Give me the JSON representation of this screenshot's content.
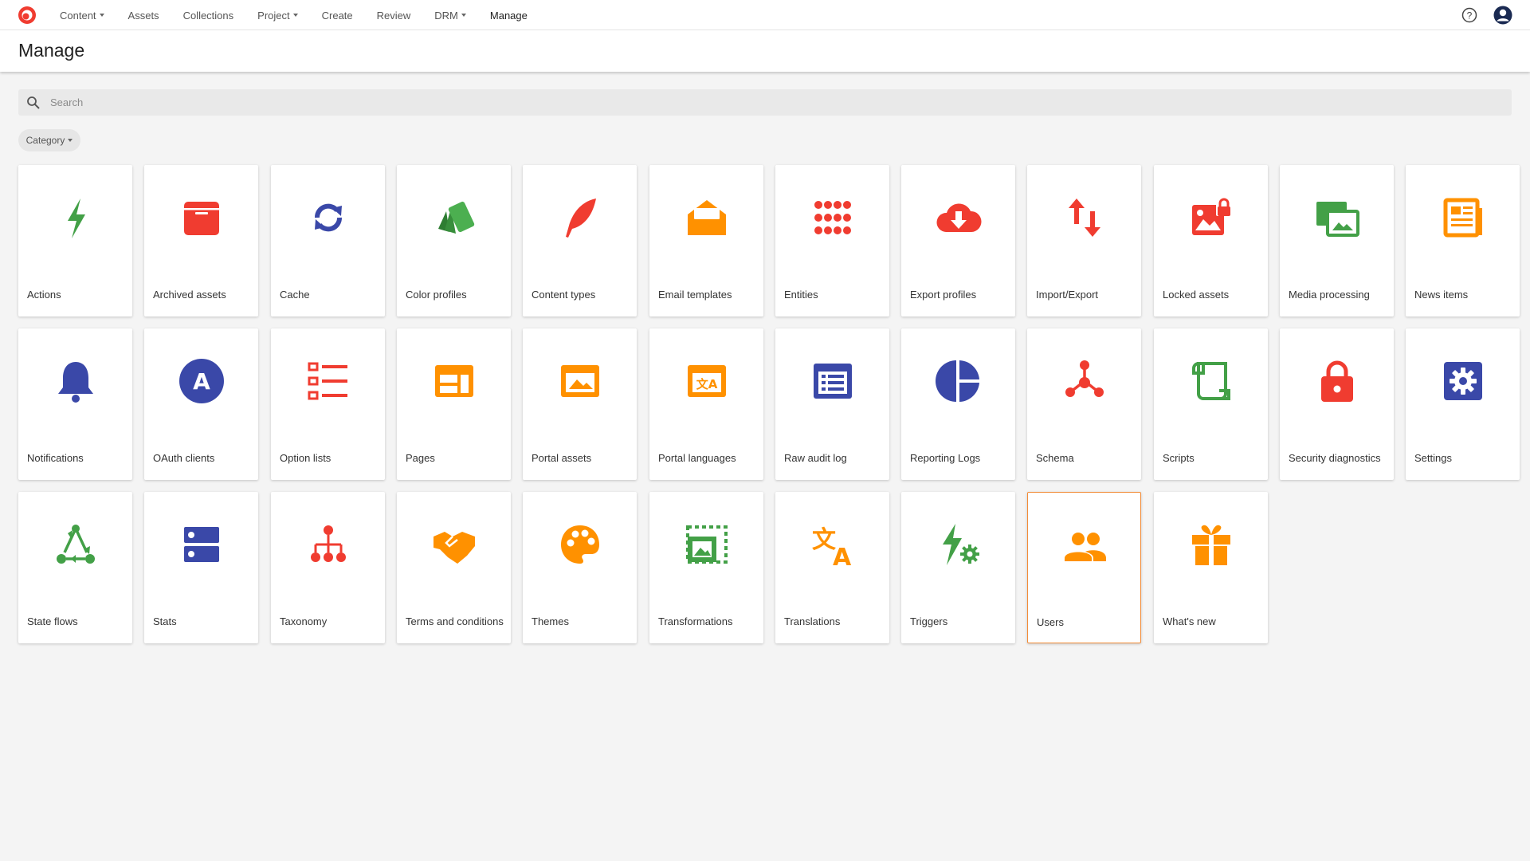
{
  "nav": {
    "items": [
      {
        "label": "Content",
        "dropdown": true
      },
      {
        "label": "Assets",
        "dropdown": false
      },
      {
        "label": "Collections",
        "dropdown": false
      },
      {
        "label": "Project",
        "dropdown": true
      },
      {
        "label": "Create",
        "dropdown": false
      },
      {
        "label": "Review",
        "dropdown": false
      },
      {
        "label": "DRM",
        "dropdown": true
      },
      {
        "label": "Manage",
        "dropdown": false,
        "active": true
      }
    ]
  },
  "header": {
    "title": "Manage"
  },
  "search": {
    "placeholder": "Search",
    "value": ""
  },
  "filter": {
    "category_label": "Category"
  },
  "colors": {
    "green": "#43a047",
    "red": "#f03c30",
    "blue": "#3a48a8",
    "orange": "#ff9100",
    "selected_border": "#f28c38"
  },
  "tiles": [
    {
      "label": "Actions",
      "icon": "bolt-icon"
    },
    {
      "label": "Archived assets",
      "icon": "archive-box-icon"
    },
    {
      "label": "Cache",
      "icon": "refresh-icon"
    },
    {
      "label": "Color profiles",
      "icon": "color-swatches-icon"
    },
    {
      "label": "Content types",
      "icon": "quill-feather-icon"
    },
    {
      "label": "Email templates",
      "icon": "open-envelope-icon"
    },
    {
      "label": "Entities",
      "icon": "dot-grid-icon"
    },
    {
      "label": "Export profiles",
      "icon": "cloud-download-icon"
    },
    {
      "label": "Import/Export",
      "icon": "up-down-arrows-icon"
    },
    {
      "label": "Locked assets",
      "icon": "locked-image-icon"
    },
    {
      "label": "Media processing",
      "icon": "media-images-icon"
    },
    {
      "label": "News items",
      "icon": "newspaper-icon"
    },
    {
      "label": "Notifications",
      "icon": "bell-icon"
    },
    {
      "label": "OAuth clients",
      "icon": "oauth-a-circle-icon"
    },
    {
      "label": "Option lists",
      "icon": "checklist-icon"
    },
    {
      "label": "Pages",
      "icon": "page-layout-icon"
    },
    {
      "label": "Portal assets",
      "icon": "portal-image-icon"
    },
    {
      "label": "Portal languages",
      "icon": "language-translate-box-icon"
    },
    {
      "label": "Raw audit log",
      "icon": "list-box-icon"
    },
    {
      "label": "Reporting Logs",
      "icon": "pie-chart-icon"
    },
    {
      "label": "Schema",
      "icon": "hub-network-icon"
    },
    {
      "label": "Scripts",
      "icon": "scroll-icon"
    },
    {
      "label": "Security diagnostics",
      "icon": "padlock-icon"
    },
    {
      "label": "Settings",
      "icon": "gear-box-icon"
    },
    {
      "label": "State flows",
      "icon": "recycle-flow-icon"
    },
    {
      "label": "Stats",
      "icon": "server-stats-icon"
    },
    {
      "label": "Taxonomy",
      "icon": "hierarchy-tree-icon"
    },
    {
      "label": "Terms and conditions",
      "icon": "handshake-icon"
    },
    {
      "label": "Themes",
      "icon": "paint-palette-icon"
    },
    {
      "label": "Transformations",
      "icon": "crop-image-icon"
    },
    {
      "label": "Translations",
      "icon": "translate-icon"
    },
    {
      "label": "Triggers",
      "icon": "bolt-gear-icon"
    },
    {
      "label": "Users",
      "icon": "people-group-icon",
      "selected": true
    },
    {
      "label": "What's new",
      "icon": "gift-icon"
    }
  ]
}
